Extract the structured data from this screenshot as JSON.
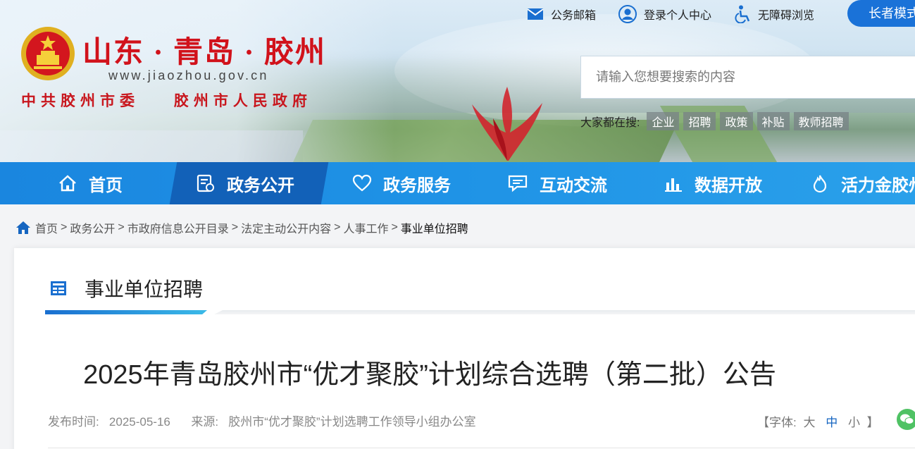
{
  "header": {
    "title": "山东 · 青岛 · 胶州",
    "url": "www.jiaozhou.gov.cn",
    "org_left": "中共胶州市委",
    "org_right": "胶州市人民政府",
    "emblem_icon": "national-emblem-icon"
  },
  "toplinks": {
    "mail": "公务邮箱",
    "login": "登录个人中心",
    "accessible": "无障碍浏览",
    "elder_mode": "长者模式"
  },
  "search": {
    "placeholder": "请输入您想要搜索的内容",
    "hot_label": "大家都在搜:",
    "hot_tags": [
      "企业",
      "招聘",
      "政策",
      "补贴",
      "教师招聘"
    ]
  },
  "nav": {
    "items": [
      {
        "label": "首页",
        "icon": "home-icon"
      },
      {
        "label": "政务公开",
        "icon": "document-icon",
        "active": true
      },
      {
        "label": "政务服务",
        "icon": "heart-icon"
      },
      {
        "label": "互动交流",
        "icon": "chat-icon"
      },
      {
        "label": "数据开放",
        "icon": "bar-chart-icon"
      },
      {
        "label": "活力金胶州",
        "icon": "flame-icon"
      }
    ]
  },
  "breadcrumb": {
    "items": [
      "首页",
      "政务公开",
      "市政府信息公开目录",
      "法定主动公开内容",
      "人事工作",
      "事业单位招聘"
    ],
    "separator": ">"
  },
  "section": {
    "title": "事业单位招聘"
  },
  "article": {
    "title": "2025年青岛胶州市“优才聚胶”计划综合选聘（第二批）公告",
    "publish_label": "发布时间:",
    "publish_date": "2025-05-16",
    "source_label": "来源:",
    "source": "胶州市“优才聚胶”计划选聘工作领导小组办公室",
    "font_label_open": "【字体:",
    "font_large": "大",
    "font_medium": "中",
    "font_small": "小",
    "font_label_close": "】"
  },
  "colors": {
    "brand_red": "#d1121b",
    "nav_blue": "#1f93e6",
    "nav_active": "#1261b8",
    "accent_blue": "#1a72d8"
  }
}
